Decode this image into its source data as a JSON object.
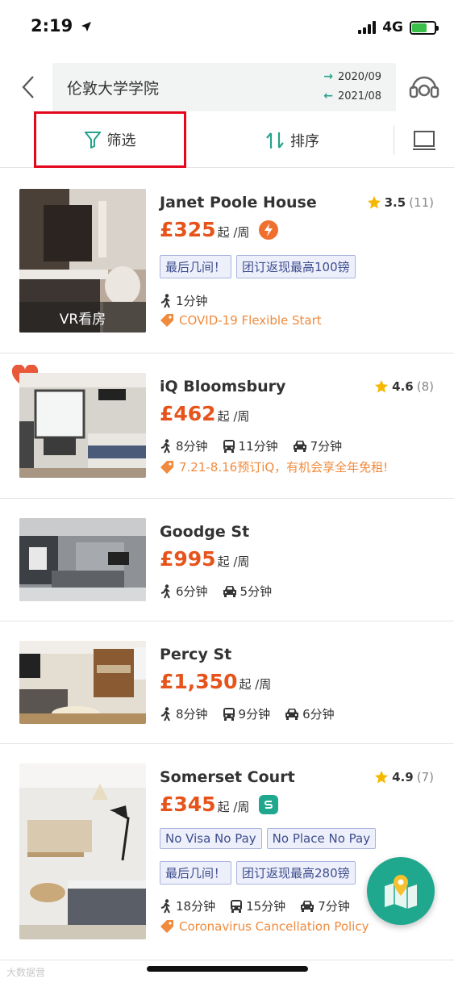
{
  "status_bar": {
    "time": "2:19",
    "network": "4G"
  },
  "search": {
    "query": "伦敦大学学院",
    "check_in": "2020/09",
    "check_out": "2021/08"
  },
  "toolbar": {
    "filter_label": "筛选",
    "sort_label": "排序"
  },
  "colors": {
    "accent": "#27a28b",
    "price": "#e6541c",
    "promo": "#f08a3c",
    "highlight_border": "#e3061c"
  },
  "listings": [
    {
      "name": "Janet Poole House",
      "rating": "3.5",
      "reviews": "(11)",
      "price": "£325",
      "price_unit": "起 /周",
      "badge_icon": "lightning-icon",
      "tags": [
        "最后几间！",
        "团订返现最高100镑"
      ],
      "walk": "1分钟",
      "promo": "COVID-19 Flexible Start",
      "vr_label": "VR看房"
    },
    {
      "name": "iQ Bloomsbury",
      "rating": "4.6",
      "reviews": "(8)",
      "price": "£462",
      "price_unit": "起 /周",
      "walk": "8分钟",
      "bus": "11分钟",
      "car": "7分钟",
      "promo": "7.21-8.16预订iQ，有机会享全年免租!",
      "favorited": true
    },
    {
      "name": "Goodge St",
      "price": "£995",
      "price_unit": "起 /周",
      "walk": "6分钟",
      "car": "5分钟"
    },
    {
      "name": "Percy St",
      "price": "£1,350",
      "price_unit": "起 /周",
      "walk": "8分钟",
      "bus": "9分钟",
      "car": "6分钟"
    },
    {
      "name": "Somerset Court",
      "rating": "4.9",
      "reviews": "(7)",
      "price": "£345",
      "price_unit": "起 /周",
      "badge_icon": "verified-brand-icon",
      "tags_row1": [
        "No Visa No Pay",
        "No Place No Pay"
      ],
      "tags_row2": [
        "最后几间！",
        "团订返现最高280镑"
      ],
      "walk": "18分钟",
      "bus": "15分钟",
      "car": "7分钟",
      "promo": "Coronavirus Cancellation Policy"
    }
  ],
  "watermark": "大数据营"
}
